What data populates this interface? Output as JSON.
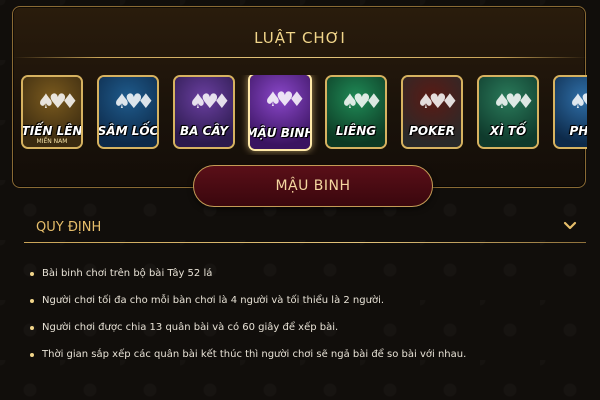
{
  "panel": {
    "title": "LUẬT CHƠI"
  },
  "games": [
    {
      "label": "TIẾN LÊN",
      "sub": "MIỀN NAM",
      "c1": "#3a2a10",
      "c2": "#7a5a1e",
      "icon": "tien-len-icon"
    },
    {
      "label": "SÂM LỐC",
      "sub": "",
      "c1": "#0d2a4a",
      "c2": "#1f5b8c",
      "icon": "sam-loc-icon"
    },
    {
      "label": "BA CÂY",
      "sub": "",
      "c1": "#2b1a4d",
      "c2": "#6a3fa0",
      "icon": "ba-cay-icon"
    },
    {
      "label": "MẬU BINH",
      "sub": "",
      "c1": "#3a1460",
      "c2": "#8a47c9",
      "icon": "mau-binh-icon",
      "active": true
    },
    {
      "label": "LIÊNG",
      "sub": "",
      "c1": "#0d3a24",
      "c2": "#1f8a56",
      "icon": "lieng-icon"
    },
    {
      "label": "POKER",
      "sub": "",
      "c1": "#2a2a2a",
      "c2": "#5a1a14",
      "icon": "poker-icon"
    },
    {
      "label": "XÌ TỐ",
      "sub": "",
      "c1": "#0f3a2c",
      "c2": "#2a7a5a",
      "icon": "xi-to-icon"
    },
    {
      "label": "PHỎ",
      "sub": "",
      "c1": "#0d2a4a",
      "c2": "#2f6fa8",
      "icon": "pho-icon"
    }
  ],
  "selected_game": {
    "label": "MẬU BINH"
  },
  "section": {
    "title": "QUY ĐỊNH"
  },
  "rules": [
    "Bài binh chơi trên bộ bài Tây 52 lá",
    "Người chơi tối đa cho mỗi bàn chơi là 4 người và tối thiểu là 2 người.",
    "Người chơi được chia 13 quân bài và có 60 giây để xếp bài.",
    "Thời gian sắp xếp các quân bài kết thúc thì người chơi sẽ ngả bài để so bài với nhau."
  ],
  "colors": {
    "gold": "#e6be6a",
    "accent_red": "#5a0f18"
  }
}
